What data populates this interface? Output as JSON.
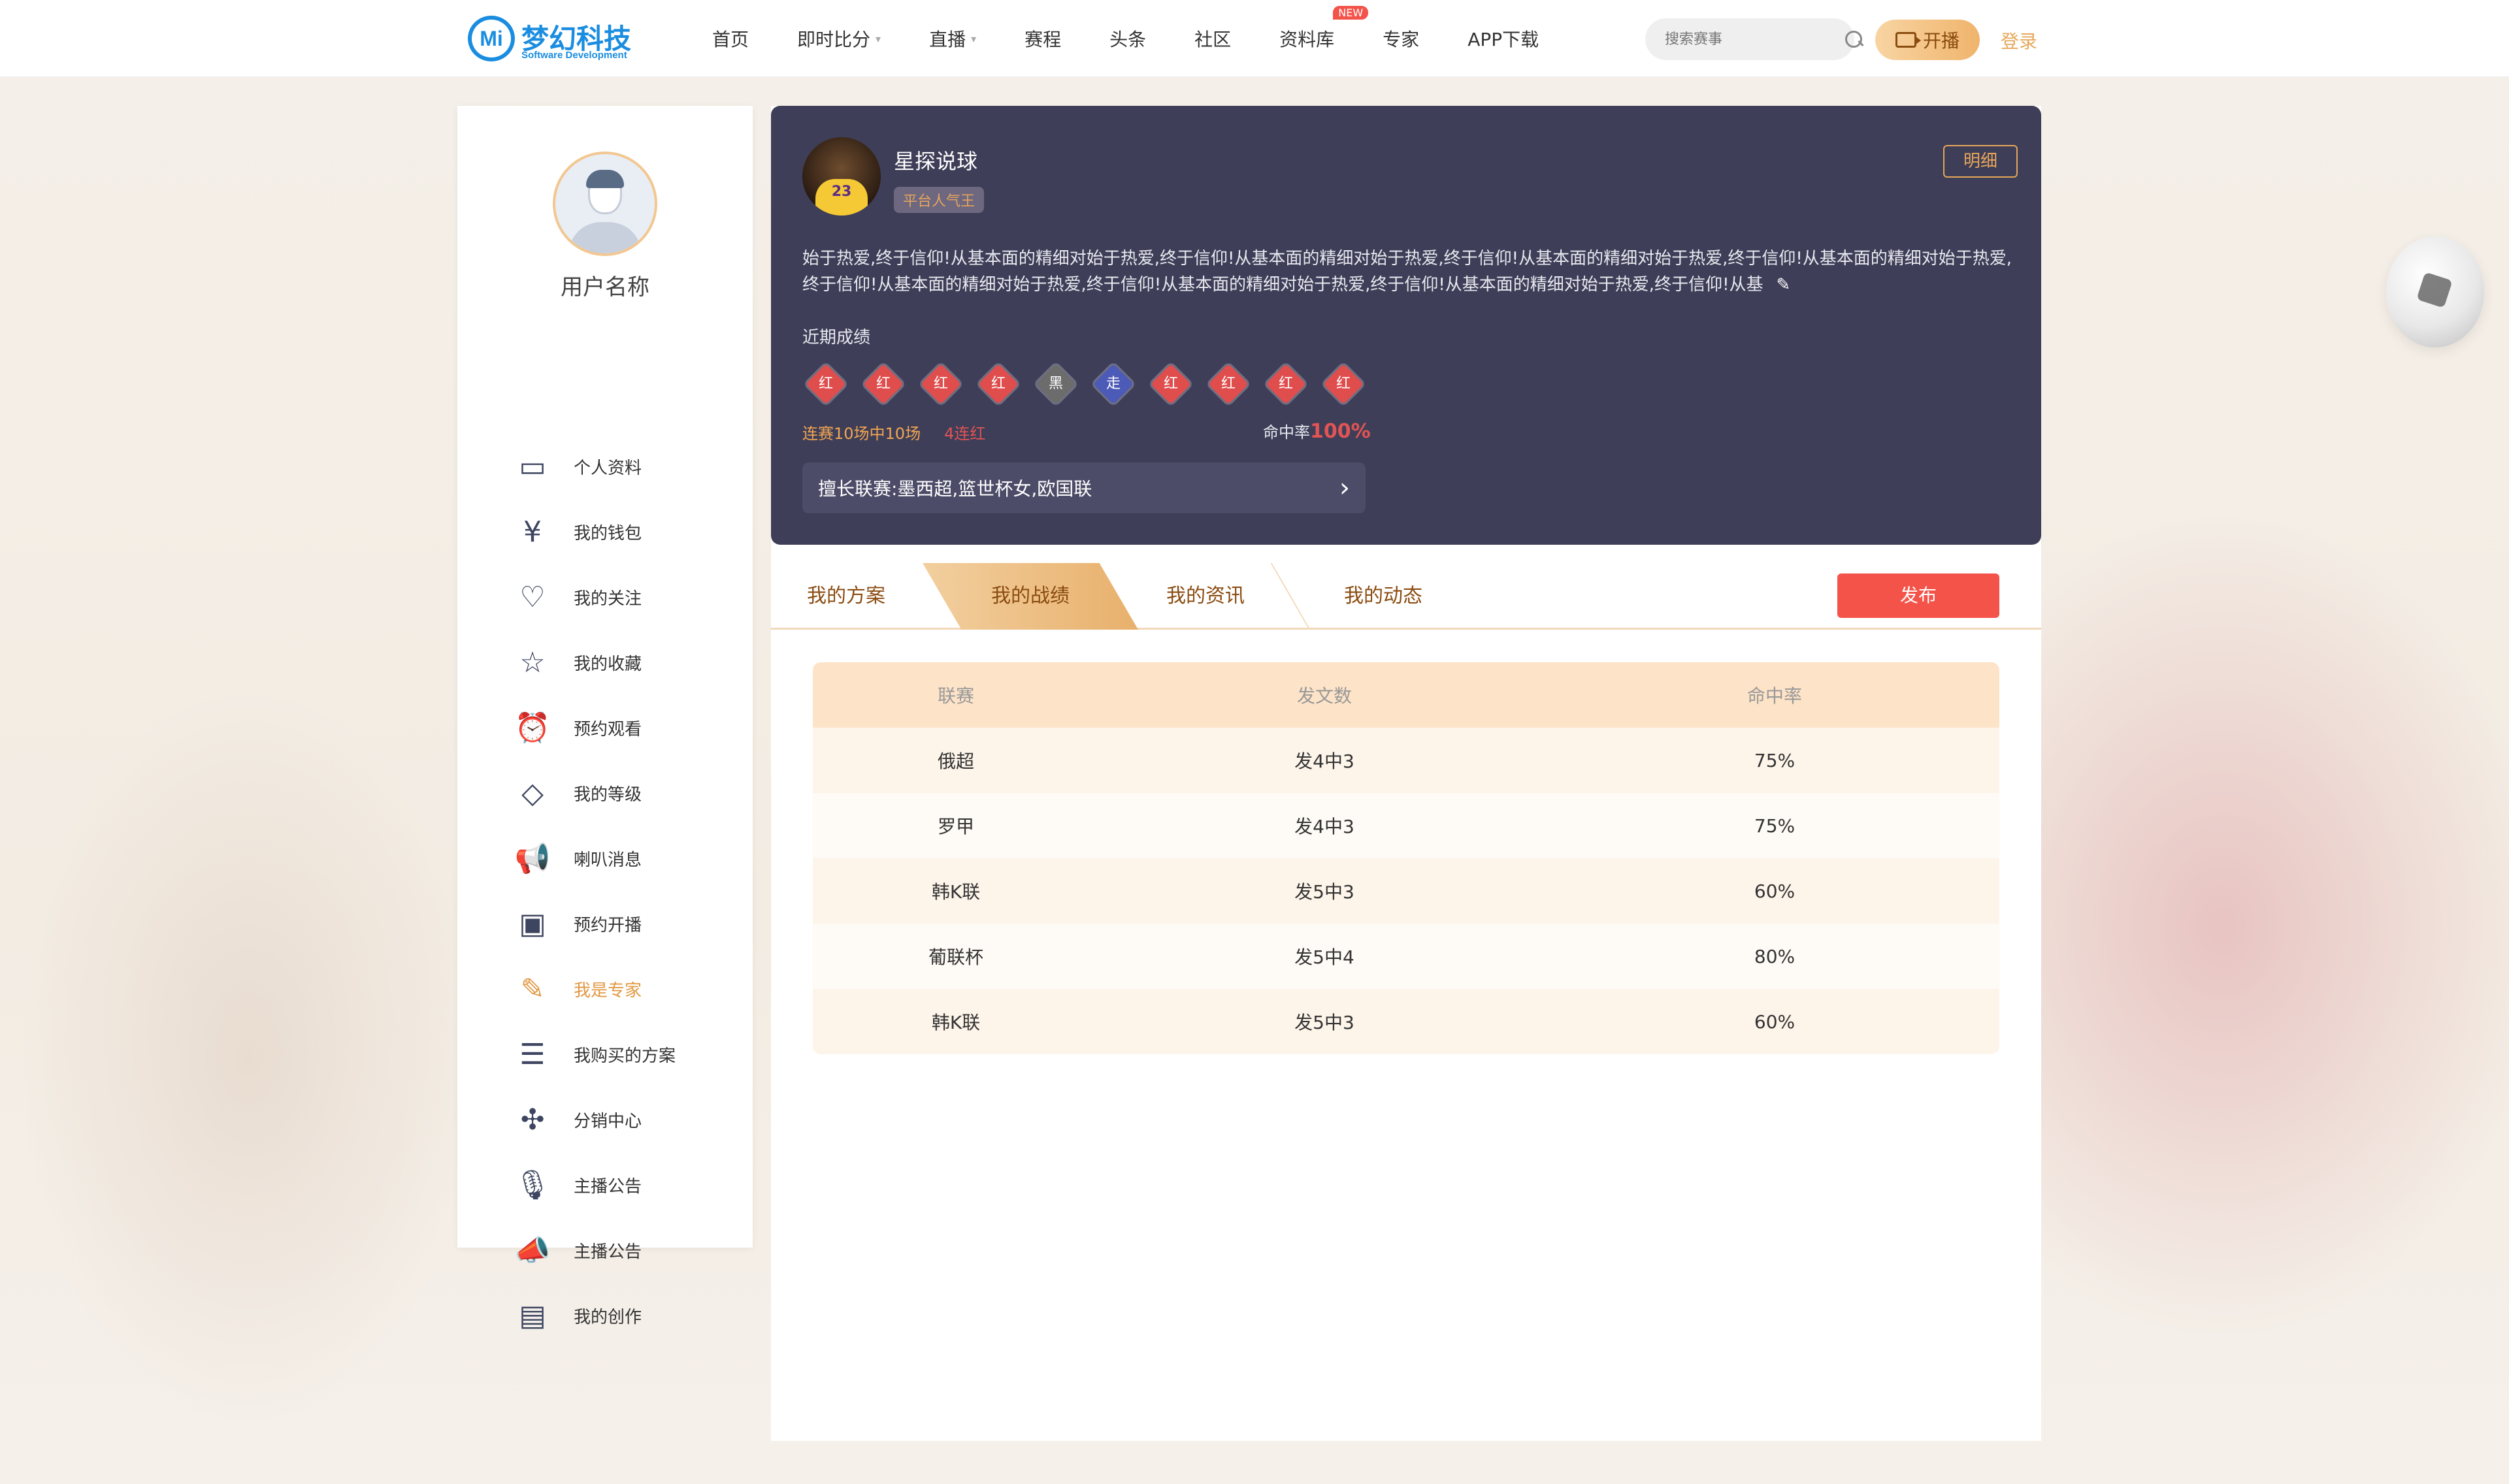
{
  "header": {
    "logo_mark": "Mi",
    "logo_name": "梦幻科技",
    "logo_sub": "Software Development",
    "nav": [
      {
        "label": "首页"
      },
      {
        "label": "即时比分",
        "caret": "▾"
      },
      {
        "label": "直播",
        "caret": "▾"
      },
      {
        "label": "赛程"
      },
      {
        "label": "头条"
      },
      {
        "label": "社区"
      },
      {
        "label": "资料库",
        "badge": "NEW"
      },
      {
        "label": "专家"
      },
      {
        "label": "APP下载"
      }
    ],
    "search_placeholder": "搜索赛事",
    "live_button": "开播",
    "login": "登录"
  },
  "sidebar": {
    "username": "用户名称",
    "items": [
      {
        "label": "个人资料",
        "icon": "id-card-icon",
        "glyph": "▭"
      },
      {
        "label": "我的钱包",
        "icon": "wallet-icon",
        "glyph": "¥"
      },
      {
        "label": "我的关注",
        "icon": "heart-icon",
        "glyph": "♡"
      },
      {
        "label": "我的收藏",
        "icon": "star-icon",
        "glyph": "☆"
      },
      {
        "label": "预约观看",
        "icon": "alarm-icon",
        "glyph": "⏰"
      },
      {
        "label": "我的等级",
        "icon": "diamond-icon",
        "glyph": "◇"
      },
      {
        "label": "喇叭消息",
        "icon": "megaphone-icon",
        "glyph": "📢"
      },
      {
        "label": "预约开播",
        "icon": "camera-icon",
        "glyph": "▣"
      },
      {
        "label": "我是专家",
        "icon": "expert-icon",
        "glyph": "✎",
        "active": true
      },
      {
        "label": "我购买的方案",
        "icon": "document-icon",
        "glyph": "☰"
      },
      {
        "label": "分销中心",
        "icon": "network-icon",
        "glyph": "✣"
      },
      {
        "label": "主播公告",
        "icon": "microphone-icon",
        "glyph": "🎙"
      },
      {
        "label": "主播公告",
        "icon": "loudspeaker-icon",
        "glyph": "📣"
      },
      {
        "label": "我的创作",
        "icon": "image-icon",
        "glyph": "▤"
      }
    ]
  },
  "profile": {
    "name": "星探说球",
    "tag": "平台人气王",
    "detail_button": "明细",
    "bio": "始于热爱,终于信仰!从基本面的精细对始于热爱,终于信仰!从基本面的精细对始于热爱,终于信仰!从基本面的精细对始于热爱,终于信仰!从基本面的精细对始于热爱,终于信仰!从基本面的精细对始于热爱,终于信仰!从基本面的精细对始于热爱,终于信仰!从基本面的精细对始于热爱,终于信仰!从基",
    "recent_label": "近期成绩",
    "results": [
      "红",
      "红",
      "红",
      "红",
      "黑",
      "走",
      "红",
      "红",
      "红",
      "红"
    ],
    "stats_text": "连赛10场中10场",
    "streak_text": "4连红",
    "rate_label": "命中率",
    "rate_value": "100%",
    "leagues_text": "擅长联赛:墨西超,篮世杯女,欧国联",
    "jersey_number": "23"
  },
  "tabs": [
    {
      "label": "我的方案"
    },
    {
      "label": "我的战绩",
      "active": true
    },
    {
      "label": "我的资讯"
    },
    {
      "label": "我的动态"
    }
  ],
  "publish_button": "发布",
  "table": {
    "headers": [
      "联赛",
      "发文数",
      "命中率"
    ],
    "rows": [
      [
        "俄超",
        "发4中3",
        "75%"
      ],
      [
        "罗甲",
        "发4中3",
        "75%"
      ],
      [
        "韩K联",
        "发5中3",
        "60%"
      ],
      [
        "葡联杯",
        "发5中4",
        "80%"
      ],
      [
        "韩K联",
        "发5中3",
        "60%"
      ]
    ]
  }
}
